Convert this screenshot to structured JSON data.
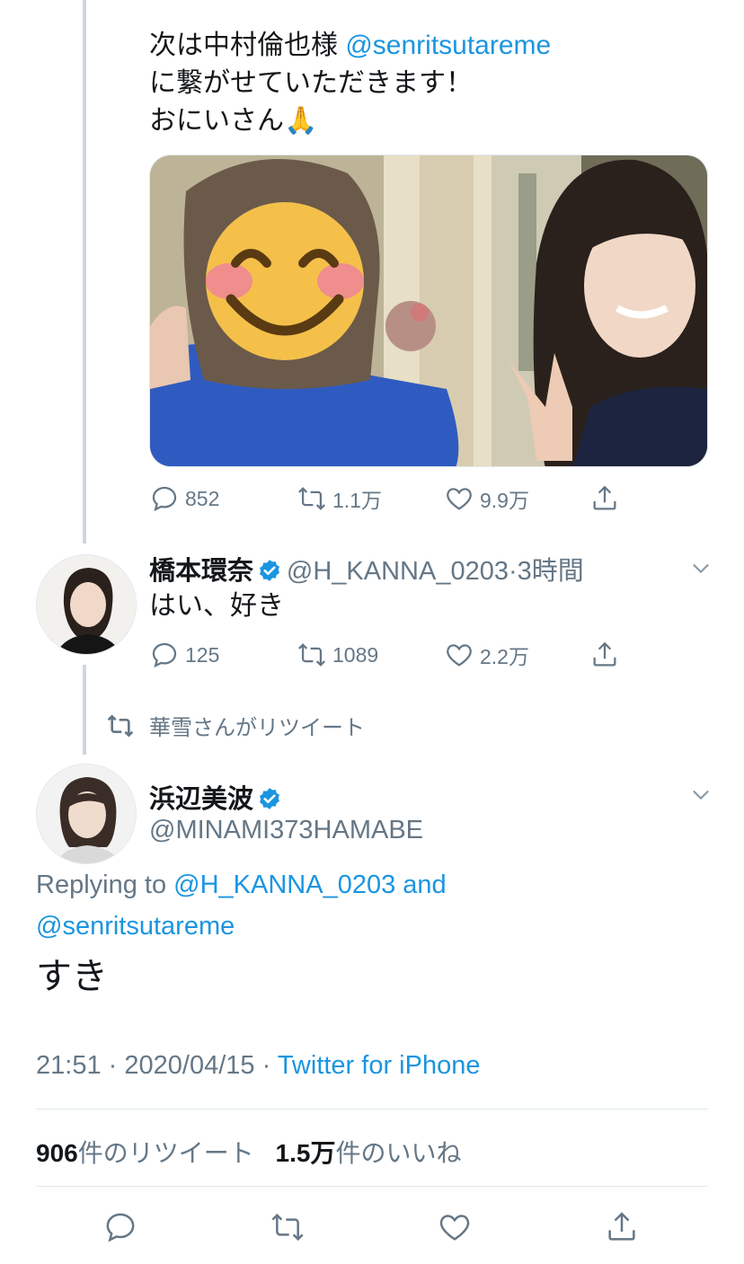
{
  "tweet1": {
    "text_line1_prefix": "次は中村倫也様 ",
    "text_line1_mention": "@senritsutareme",
    "text_line2": "に繋がせていただきます！",
    "text_line3": "おにいさん🙏",
    "replies": "852",
    "retweets": "1.1万",
    "likes": "9.9万"
  },
  "tweet2": {
    "name": "橋本環奈",
    "handle": "@H_KANNA_0203",
    "separator": "·",
    "time": "3時間",
    "text": "はい、好き",
    "replies": "125",
    "retweets": "1089",
    "likes": "2.2万"
  },
  "retweet_context": {
    "label": "華雪さんがリツイート"
  },
  "main_tweet": {
    "name": "浜辺美波",
    "handle": "@MINAMI373HAMABE",
    "replying_prefix": "Replying to ",
    "replying_mention1": "@H_KANNA_0203",
    "replying_and": " and",
    "replying_mention2": "@senritsutareme",
    "text": "すき",
    "time": "21:51",
    "date": "2020/04/15",
    "dot": "·",
    "source": "Twitter for iPhone",
    "retweet_count": "906",
    "retweet_label": "件のリツイート",
    "like_count": "1.5万",
    "like_label": "件のいいね"
  },
  "colors": {
    "accent": "#1b95e0",
    "muted": "#657786",
    "text": "#14171a"
  }
}
